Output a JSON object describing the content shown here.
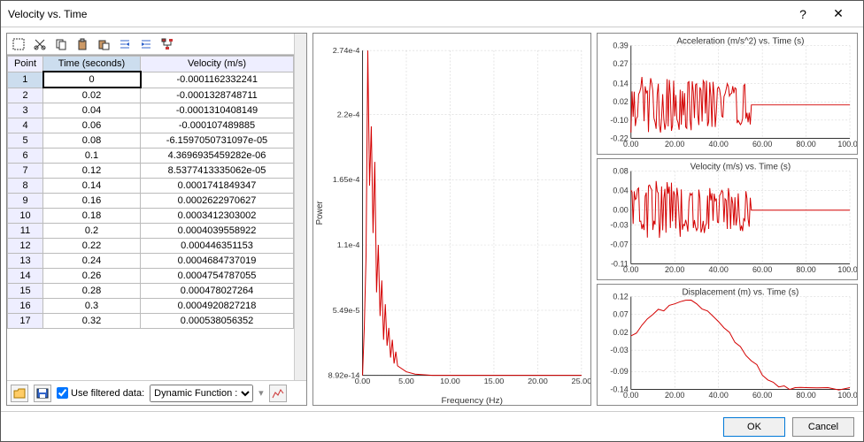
{
  "window": {
    "title": "Velocity vs. Time",
    "help": "?",
    "close": "✕"
  },
  "toolbar_icons": [
    "select",
    "cut",
    "copy",
    "paste",
    "paste2",
    "indent",
    "outdent",
    "tree"
  ],
  "table": {
    "headers": {
      "point": "Point",
      "time": "Time (seconds)",
      "velocity": "Velocity (m/s)"
    },
    "rows": [
      {
        "p": "1",
        "t": "0",
        "v": "-0.0001162332241"
      },
      {
        "p": "2",
        "t": "0.02",
        "v": "-0.0001328748711"
      },
      {
        "p": "3",
        "t": "0.04",
        "v": "-0.0001310408149"
      },
      {
        "p": "4",
        "t": "0.06",
        "v": "-0.000107489885"
      },
      {
        "p": "5",
        "t": "0.08",
        "v": "-6.1597050731097e-05"
      },
      {
        "p": "6",
        "t": "0.1",
        "v": "4.3696935459282e-06"
      },
      {
        "p": "7",
        "t": "0.12",
        "v": "8.5377413335062e-05"
      },
      {
        "p": "8",
        "t": "0.14",
        "v": "0.0001741849347"
      },
      {
        "p": "9",
        "t": "0.16",
        "v": "0.0002622970627"
      },
      {
        "p": "10",
        "t": "0.18",
        "v": "0.0003412303002"
      },
      {
        "p": "11",
        "t": "0.2",
        "v": "0.0004039558922"
      },
      {
        "p": "12",
        "t": "0.22",
        "v": "0.000446351153"
      },
      {
        "p": "13",
        "t": "0.24",
        "v": "0.0004684737019"
      },
      {
        "p": "14",
        "t": "0.26",
        "v": "0.0004754787055"
      },
      {
        "p": "15",
        "t": "0.28",
        "v": "0.000478027264"
      },
      {
        "p": "16",
        "t": "0.3",
        "v": "0.0004920827218"
      },
      {
        "p": "17",
        "t": "0.32",
        "v": "0.000538056352"
      }
    ]
  },
  "left_foot": {
    "use_filtered_label": "Use filtered data:",
    "use_filtered_checked": true,
    "dropdown_selected": "Dynamic Function :"
  },
  "footer": {
    "ok": "OK",
    "cancel": "Cancel"
  },
  "chart_data": [
    {
      "id": "main",
      "type": "line",
      "title": "",
      "xlabel": "Frequency (Hz)",
      "ylabel": "Power",
      "xlim": [
        0,
        25
      ],
      "ylim": [
        0,
        0.000274
      ],
      "xticks": [
        0,
        5,
        10,
        15,
        20,
        25
      ],
      "xtick_labels": [
        "0.00",
        "5.00",
        "10.00",
        "15.00",
        "20.00",
        "25.00"
      ],
      "yticks": [
        8.92e-14,
        5.49e-05,
        0.00011,
        0.000165,
        0.00022,
        0.000274
      ],
      "ytick_labels": [
        "8.92e-14",
        "5.49e-5",
        "1.1e-4",
        "1.65e-4",
        "2.2e-4",
        "2.74e-4"
      ],
      "x": [
        0.0,
        0.2,
        0.4,
        0.6,
        0.8,
        1.0,
        1.2,
        1.4,
        1.6,
        1.8,
        2.0,
        2.2,
        2.4,
        2.6,
        2.8,
        3.0,
        3.2,
        3.4,
        3.6,
        3.8,
        4.0,
        5.0,
        6.0,
        8.0,
        10.0,
        15.0,
        20.0,
        25.0
      ],
      "y": [
        0,
        4e-05,
        0.0001,
        0.000274,
        0.00016,
        0.00021,
        0.00012,
        0.00018,
        7e-05,
        0.00011,
        5e-05,
        8e-05,
        3e-05,
        6e-05,
        2.5e-05,
        4e-05,
        1.5e-05,
        3e-05,
        1e-05,
        2e-05,
        8e-06,
        3e-06,
        1e-06,
        0,
        0,
        0,
        0,
        0
      ]
    },
    {
      "id": "accel",
      "type": "line",
      "title": "Acceleration (m/s^2) vs. Time (s)",
      "xlabel": "",
      "ylabel": "",
      "xlim": [
        0,
        100
      ],
      "ylim": [
        -0.22,
        0.39
      ],
      "xticks": [
        0,
        20,
        40,
        60,
        80,
        100
      ],
      "xtick_labels": [
        "0.00",
        "20.00",
        "40.00",
        "60.00",
        "80.00",
        "100.00"
      ],
      "yticks": [
        -0.22,
        -0.1,
        0.02,
        0.14,
        0.27,
        0.39
      ],
      "ytick_labels": [
        "-0.22",
        "-0.10",
        "0.02",
        "0.14",
        "0.27",
        "0.39"
      ],
      "note": "noisy oscillation ~±0.2 for t<55, then ~0"
    },
    {
      "id": "vel",
      "type": "line",
      "title": "Velocity (m/s) vs. Time (s)",
      "xlabel": "",
      "ylabel": "",
      "xlim": [
        0,
        100
      ],
      "ylim": [
        -0.11,
        0.08
      ],
      "xticks": [
        0,
        20,
        40,
        60,
        80,
        100
      ],
      "xtick_labels": [
        "0.00",
        "20.00",
        "40.00",
        "60.00",
        "80.00",
        "100.00"
      ],
      "yticks": [
        -0.11,
        -0.07,
        -0.03,
        0,
        0.04,
        0.08
      ],
      "ytick_labels": [
        "-0.11",
        "-0.07",
        "-0.03",
        "0.00",
        "0.04",
        "0.08"
      ],
      "note": "noisy oscillation ~±0.05 for t<55, then ~0"
    },
    {
      "id": "disp",
      "type": "line",
      "title": "Displacement (m) vs. Time (s)",
      "xlabel": "",
      "ylabel": "",
      "xlim": [
        0,
        100
      ],
      "ylim": [
        -0.14,
        0.12
      ],
      "xticks": [
        0,
        20,
        40,
        60,
        80,
        100
      ],
      "xtick_labels": [
        "0.00",
        "20.00",
        "40.00",
        "60.00",
        "80.00",
        "100.00"
      ],
      "yticks": [
        -0.14,
        -0.09,
        -0.03,
        0.02,
        0.07,
        0.12
      ],
      "ytick_labels": [
        "-0.14",
        "-0.09",
        "-0.03",
        "0.02",
        "0.07",
        "0.12"
      ],
      "x": [
        0,
        5,
        10,
        15,
        20,
        25,
        30,
        35,
        40,
        45,
        50,
        55,
        60,
        65,
        70,
        75,
        80,
        90,
        100
      ],
      "y": [
        0.01,
        0.04,
        0.07,
        0.08,
        0.1,
        0.11,
        0.1,
        0.08,
        0.05,
        0.02,
        -0.02,
        -0.06,
        -0.1,
        -0.12,
        -0.13,
        -0.135,
        -0.135,
        -0.135,
        -0.135
      ]
    }
  ]
}
